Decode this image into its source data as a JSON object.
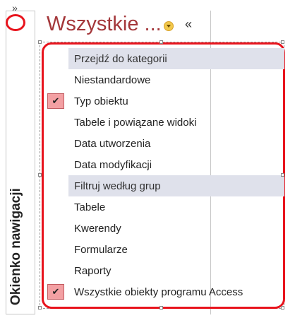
{
  "pane": {
    "title": "Wszystkie ...",
    "collapsed_label": "Okienko nawigacji",
    "expand_button": "»",
    "collapse_button": "«"
  },
  "menu": {
    "items": [
      {
        "label": "Przejdź do kategorii",
        "type": "header",
        "checked": false
      },
      {
        "label": "Niestandardowe",
        "type": "item",
        "checked": false
      },
      {
        "label": "Typ obiektu",
        "type": "item",
        "checked": true
      },
      {
        "label": "Tabele i powiązane widoki",
        "type": "item",
        "checked": false
      },
      {
        "label": "Data utworzenia",
        "type": "item",
        "checked": false
      },
      {
        "label": "Data modyfikacji",
        "type": "item",
        "checked": false
      },
      {
        "label": "Filtruj według grup",
        "type": "header",
        "checked": false
      },
      {
        "label": "Tabele",
        "type": "item",
        "checked": false
      },
      {
        "label": "Kwerendy",
        "type": "item",
        "checked": false
      },
      {
        "label": "Formularze",
        "type": "item",
        "checked": false
      },
      {
        "label": "Raporty",
        "type": "item",
        "checked": false
      },
      {
        "label": "Wszystkie obiekty programu Access",
        "type": "item",
        "checked": true
      }
    ],
    "check_glyph": "✔"
  },
  "colors": {
    "annotation_red": "#e8141d",
    "title_color": "#a4373a",
    "header_bg": "#dfe1eb",
    "check_bg": "#f3a0a3"
  }
}
